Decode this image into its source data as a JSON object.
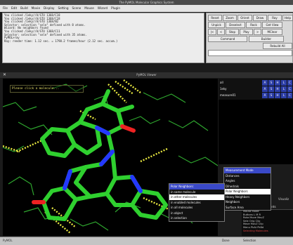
{
  "top_window": {
    "title": "The PyMOL Molecular Graphics System",
    "menu": [
      "File",
      "Edit",
      "Build",
      "Movie",
      "Display",
      "Setting",
      "Scene",
      "Mouse",
      "Wizard",
      "Plugin"
    ],
    "console_lines": [
      "You clicked /1eky//A/STU 1368/C18",
      "You clicked /1eky//A/STU 1368/C18",
      "You clicked /1eky//A/STU 1368/N2",
      "Selector: selection \"sele\" defined with 8 atoms.",
      "Wizard: No neighbors found",
      "You clicked /1eky//A/STU 1368/C11",
      "Selector: selection \"sele\" defined with 35 atoms.",
      "PyMOL>ray",
      "  Ray: render time: 1.12 sec. = 1798.2 frames/hour (2.12 sec. accum.)"
    ],
    "buttons_row1": [
      "Reset",
      "Zoom",
      "Orient",
      "Draw",
      "Ray"
    ],
    "buttons_row2": [
      "Unpick",
      "Deselect",
      "Rock",
      "Get View"
    ],
    "buttons_row3": [
      "|<",
      "<",
      "Stop",
      "Play",
      ">",
      "MClear"
    ],
    "builder_label": "Builder",
    "rebuild_label": "Rebuild All",
    "command_label": "Command",
    "right_edge_label": "Help"
  },
  "viewer": {
    "title": "PyMOL Viewer",
    "prompt": "Please click a molecule...",
    "objects": [
      {
        "name": "all"
      },
      {
        "name": "1eky"
      },
      {
        "name": "measure01"
      }
    ],
    "object_buttons": [
      "A",
      "S",
      "H",
      "L",
      "C"
    ],
    "mode_menu": {
      "header": "Measurement Mode",
      "items": [
        "Distances",
        "Angles",
        "Dihedrals",
        "Polar Neighbors",
        "Heavy Neighbors",
        "Neighbors",
        "Surface Area"
      ],
      "selected": "Polar Neighbors"
    },
    "polar_menu": {
      "header": "Polar Neighbors:",
      "items": [
        "in same molecule",
        "in other molecules",
        "in enabled molecules",
        "in all molecules",
        "in object",
        "in selection"
      ],
      "selected": "in other molecules"
    },
    "side_labels": [
      "Visualiz",
      "Selection",
      "Done"
    ],
    "ments_label": "ments",
    "mouse_panel": {
      "lines": [
        "Mouse Mode",
        "Buttons L M R",
        "Rota Move MovZ",
        "Sele Orig Clip",
        "Move MovZ Clip",
        "Menu PkAt PkBd"
      ],
      "footer": "Selecting Molecules"
    },
    "status_text": "PyMOL"
  },
  "colors": {
    "carbon_green": "#2fd02f",
    "nitrogen_blue": "#2438ff",
    "oxygen_red": "#ee2222",
    "hbond_yellow": "#e8e840",
    "menu_header_blue": "#3a49c8",
    "object_button_blue": "#2d3fa8"
  }
}
